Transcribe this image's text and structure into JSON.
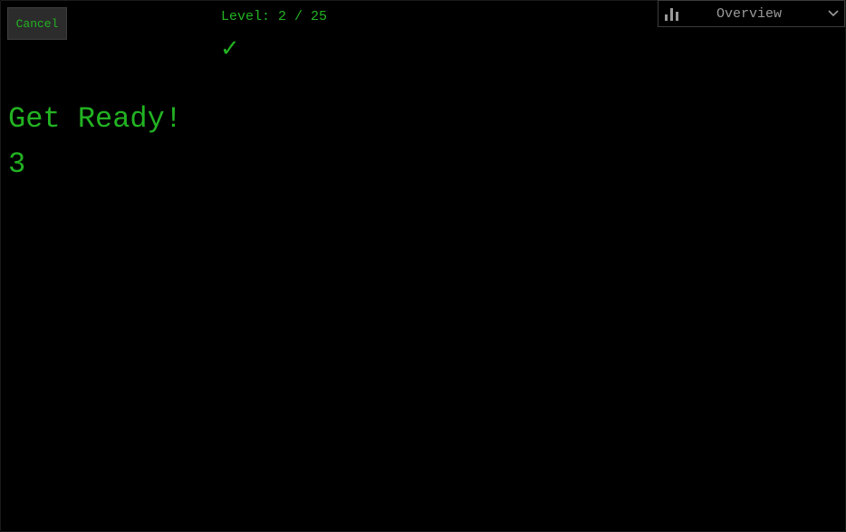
{
  "game": {
    "cancel_label": "Cancel",
    "level_text": "Level: 2 / 25",
    "status_icon": "checkmark-icon",
    "check_glyph": "✓",
    "message": "Get Ready!",
    "countdown": "3"
  },
  "view_select": {
    "icon": "bar-chart-icon",
    "selected_label": "Overview"
  },
  "colors": {
    "accent_green": "#22b322",
    "background": "#000000",
    "button_bg": "#2c2c2c",
    "select_text": "#9a9a9a"
  }
}
